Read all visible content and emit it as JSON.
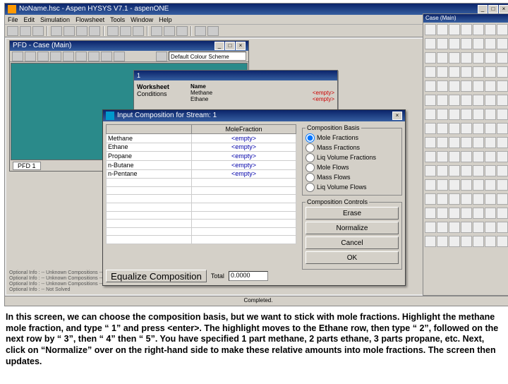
{
  "main_title": "NoName.hsc - Aspen HYSYS V7.1 - aspenONE",
  "menu": [
    "File",
    "Edit",
    "Simulation",
    "Flowsheet",
    "Tools",
    "Window",
    "Help"
  ],
  "pfd_title": "PFD - Case (Main)",
  "pfd_tab": "PFD 1",
  "palette_title": "Case (Main)",
  "toolbar_dropdown": "Default Colour Scheme",
  "worksheet": {
    "title": "1",
    "group": "Worksheet",
    "item": "Conditions",
    "right_header": "Name",
    "components": [
      "Methane",
      "Ethane"
    ],
    "flag": "<empty>"
  },
  "dialog": {
    "title": "Input Composition for Stream: 1",
    "header_component": "",
    "header_value": "MoleFraction",
    "rows": [
      {
        "name": "Methane",
        "value": "<empty>"
      },
      {
        "name": "Ethane",
        "value": "<empty>"
      },
      {
        "name": "Propane",
        "value": "<empty>"
      },
      {
        "name": "n-Butane",
        "value": "<empty>"
      },
      {
        "name": "n-Pentane",
        "value": "<empty>"
      }
    ],
    "basis_title": "Composition Basis",
    "basis": [
      "Mole Fractions",
      "Mass Fractions",
      "Liq Volume Fractions",
      "Mole Flows",
      "Mass Flows",
      "Liq Volume Flows"
    ],
    "controls_title": "Composition Controls",
    "erase": "Erase",
    "normalize": "Normalize",
    "cancel": "Cancel",
    "ok": "OK",
    "equalize": "Equalize Composition",
    "total_label": "Total",
    "total_value": "0.0000"
  },
  "optional_info": [
    "Optional Info : -- Unknown Compositions --",
    "Optional Info : -- Unknown Compositions --",
    "Optional Info : -- Unknown Compositions --",
    "Optional Info : -- Not Solved"
  ],
  "status": "Completed.",
  "caption": "In this screen, we can choose the composition basis, but we want to stick with mole fractions. Highlight the methane mole fraction, and type “ 1” and press <enter>. The highlight moves to the Ethane row, then type “ 2”, followed on the next row by “ 3”, then “ 4” then “ 5”. You have specified 1 part methane, 2 parts ethane, 3 parts propane, etc. Next, click on “Normalize” over on the right-hand side to make these relative amounts into mole fractions. The screen then updates."
}
